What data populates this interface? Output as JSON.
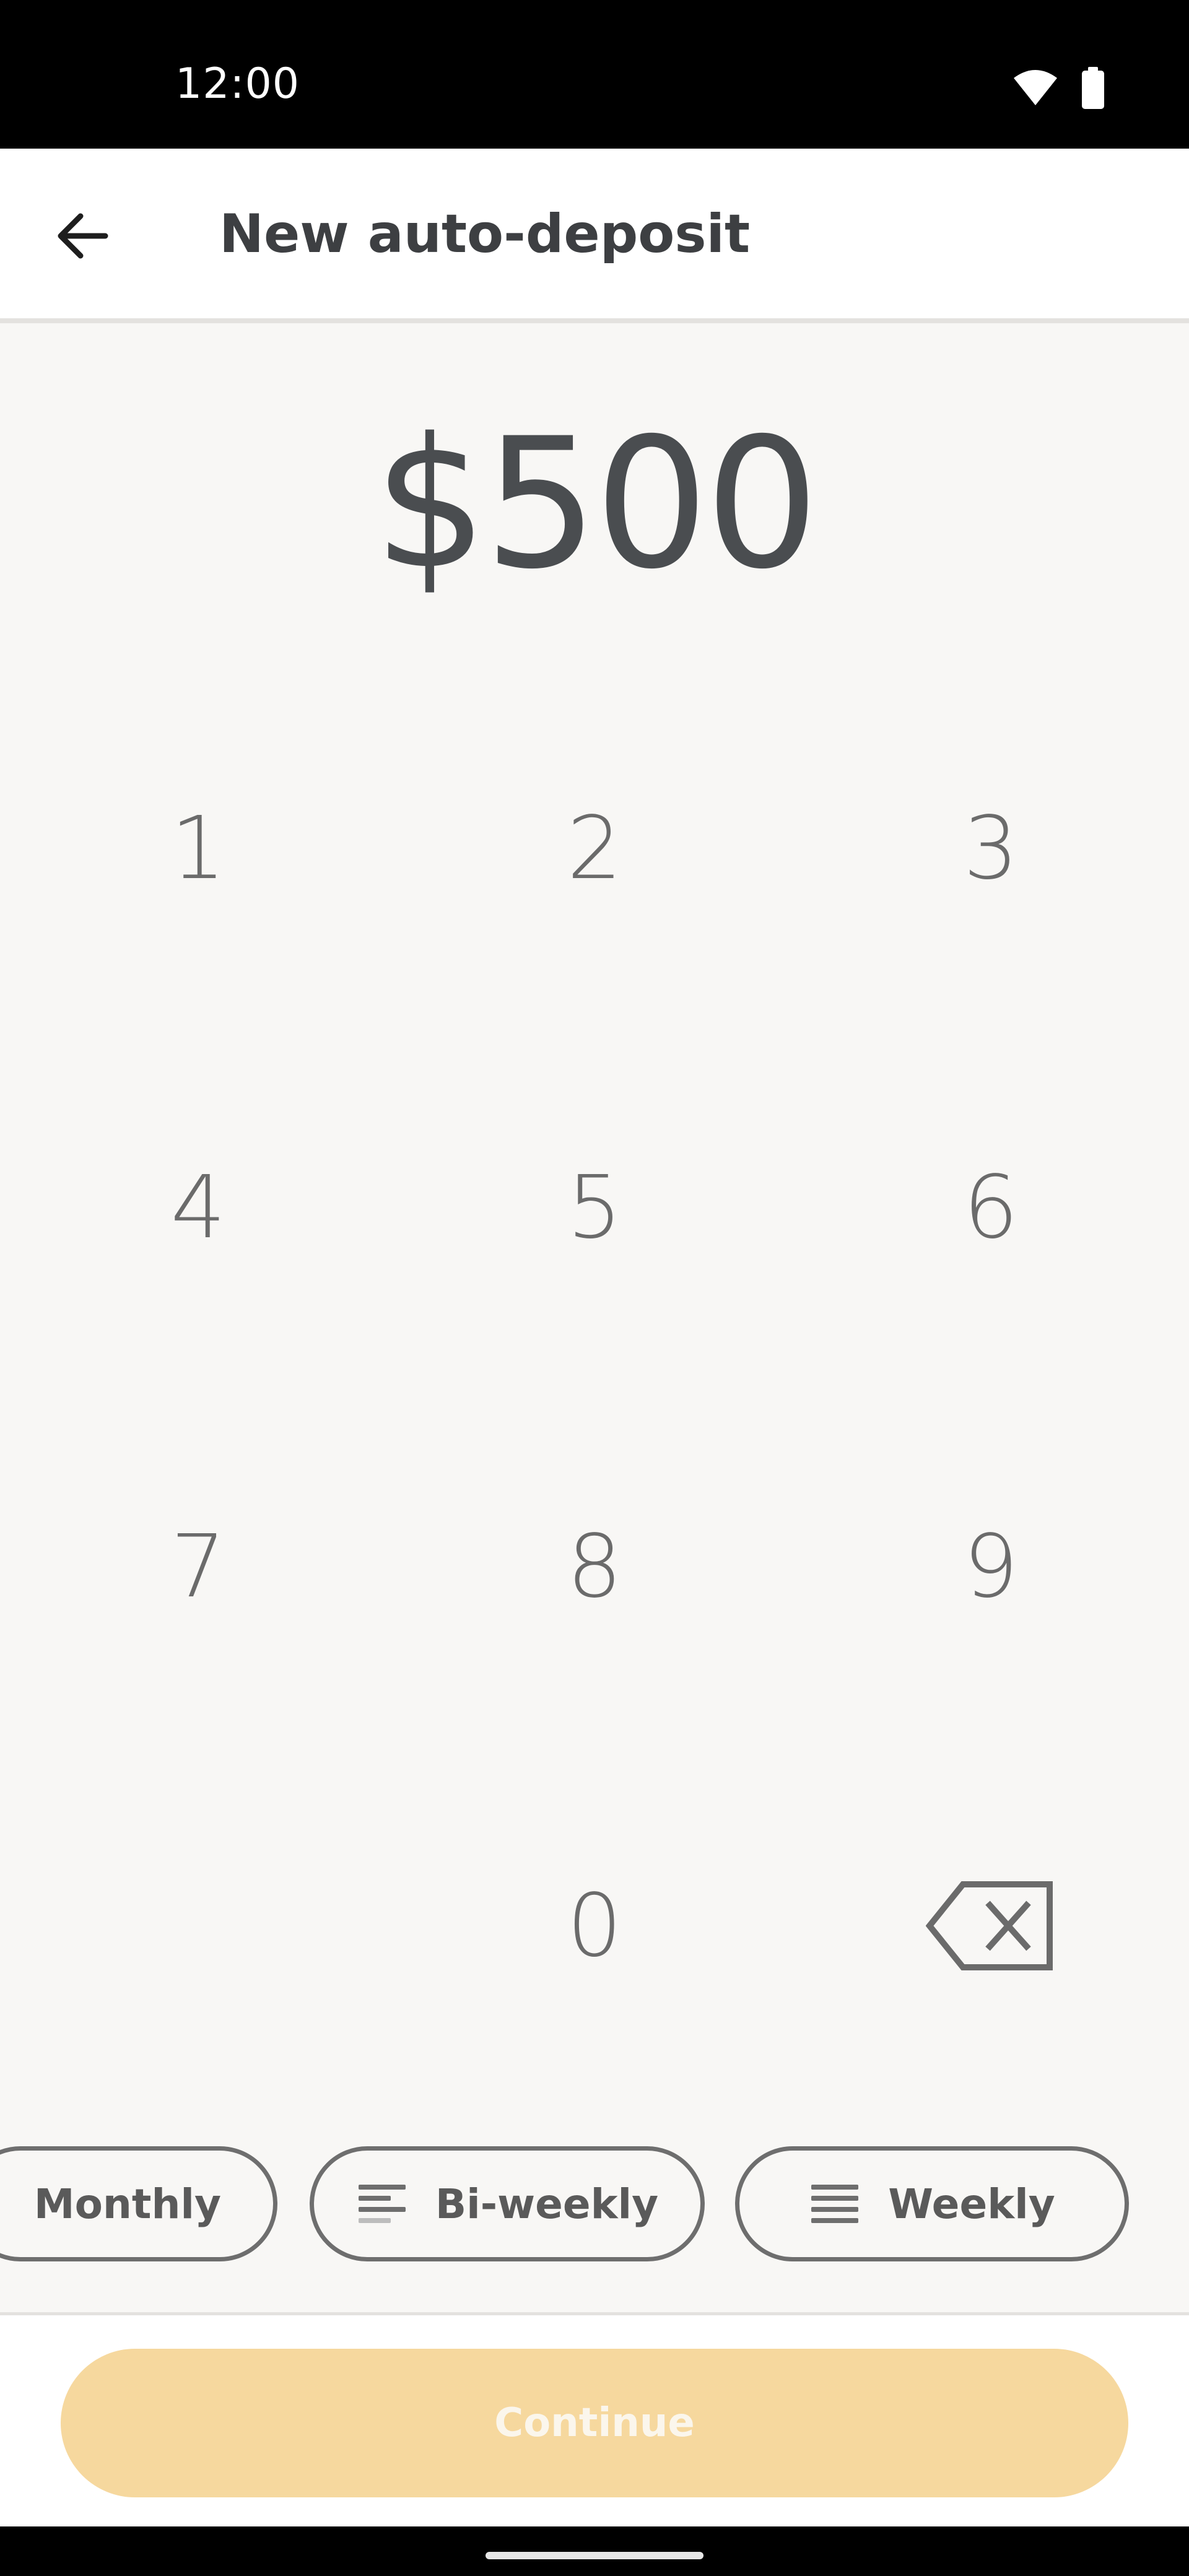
{
  "status_bar": {
    "time": "12:00",
    "icons": [
      "wifi-icon",
      "battery-icon"
    ]
  },
  "app_bar": {
    "back_icon": "arrow-left-icon",
    "title": "New auto-deposit"
  },
  "amount": {
    "value": "$500"
  },
  "keypad": {
    "keys": [
      "1",
      "2",
      "3",
      "4",
      "5",
      "6",
      "7",
      "8",
      "9",
      "0"
    ],
    "backspace_icon": "backspace-icon"
  },
  "frequency": {
    "options": [
      {
        "label": "Monthly",
        "icon": "none"
      },
      {
        "label": "Bi-weekly",
        "icon": "bi-weekly-lines-icon"
      },
      {
        "label": "Weekly",
        "icon": "weekly-lines-icon"
      }
    ]
  },
  "footer": {
    "continue_label": "Continue"
  },
  "colors": {
    "background": "#f8f7f5",
    "accent_disabled": "#f6d89e",
    "text_dark": "#3d3f42",
    "keypad_text": "#6b6b6b"
  }
}
